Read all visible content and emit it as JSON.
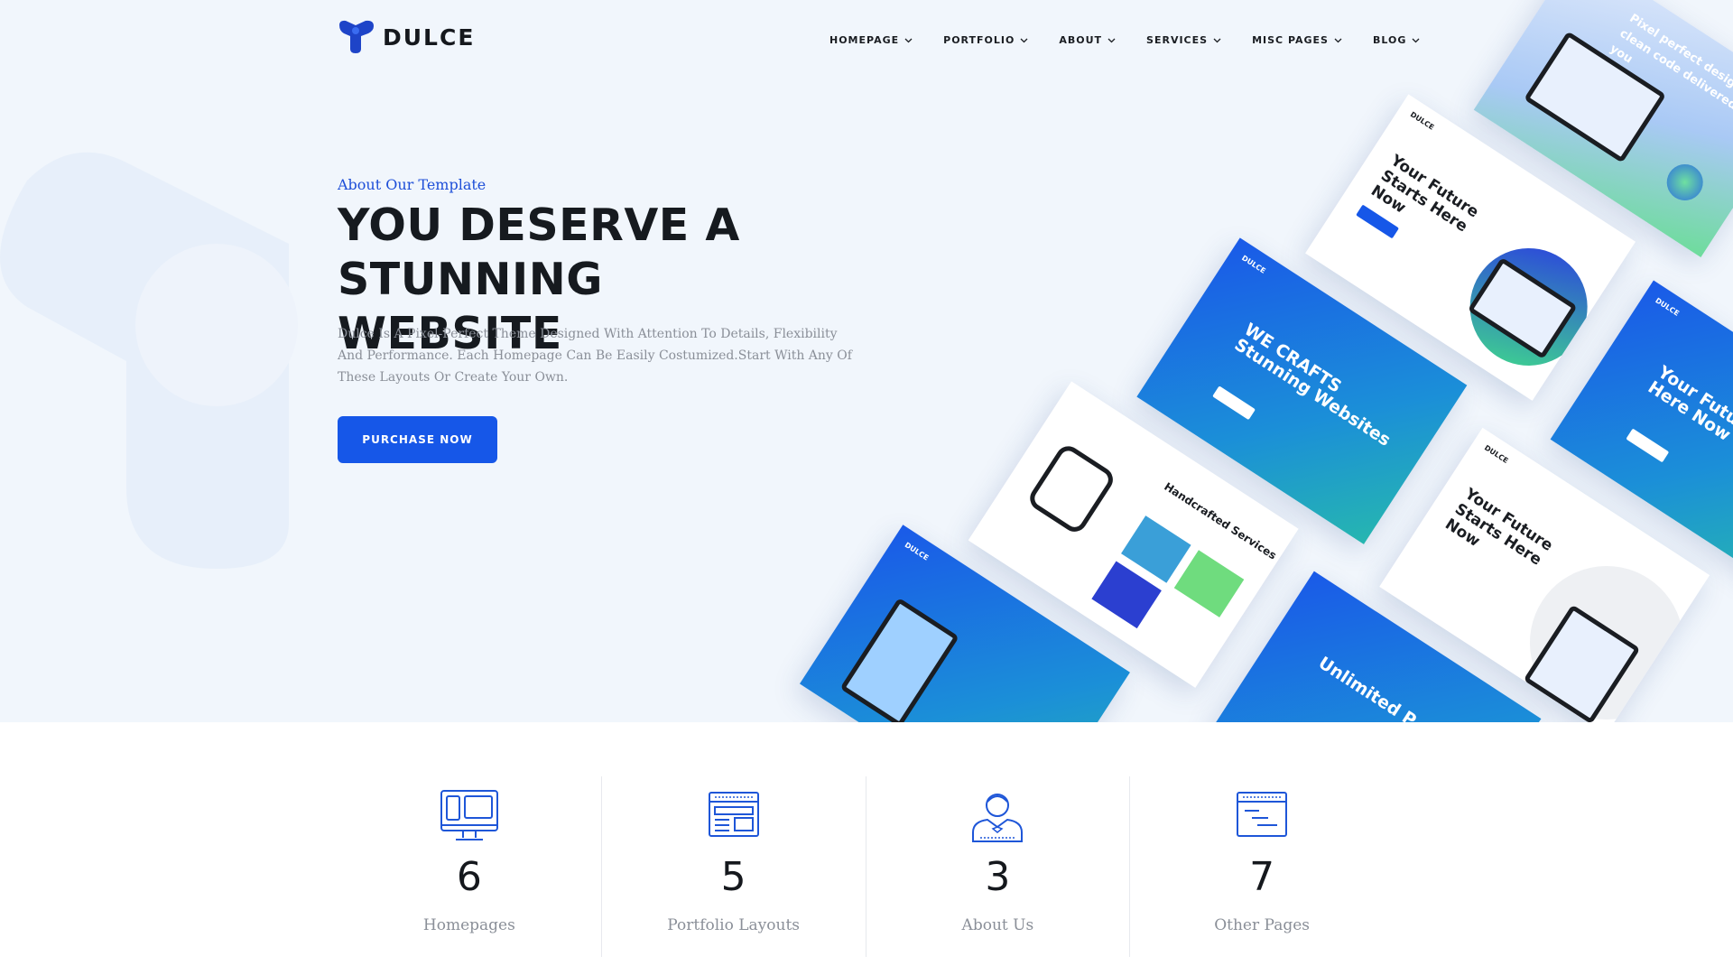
{
  "brand": {
    "name": "DULCE",
    "accent": "#1657e8"
  },
  "nav": {
    "items": [
      {
        "label": "HOMEPAGE"
      },
      {
        "label": "PORTFOLIO"
      },
      {
        "label": "ABOUT"
      },
      {
        "label": "SERVICES"
      },
      {
        "label": "MISC PAGES"
      },
      {
        "label": "BLOG"
      }
    ],
    "chevron_icon": "chevron-down-icon"
  },
  "hero": {
    "eyebrow": "About Our Template",
    "headline_line1": "YOU DESERVE A",
    "headline_line2": "STUNNING WEBSITE",
    "description": "Dulce Is A Pixel-Perfect Theme Designed With Attention To Details, Flexibility And Performance. Each Homepage Can Be Easily Costumized.Start With Any Of These Layouts Or Create Your Own.",
    "cta_label": "PURCHASE NOW"
  },
  "mockups": {
    "tile_1": "Pixel perfect design and clean code delivered to you",
    "tile_2": "Your Future Starts Here Now",
    "tile_3": "WE CRAFTS Stunning Websites",
    "tile_4": "Handcrafted Services",
    "tile_5": "Your Future Starts Here Now",
    "tile_6": "Unlimited P",
    "mini_logo": "DULCE"
  },
  "stats": [
    {
      "value": "6",
      "label": "Homepages",
      "icon": "desktop-devices-icon"
    },
    {
      "value": "5",
      "label": "Portfolio Layouts",
      "icon": "browser-layout-icon"
    },
    {
      "value": "3",
      "label": "About Us",
      "icon": "person-icon"
    },
    {
      "value": "7",
      "label": "Other Pages",
      "icon": "document-window-icon"
    }
  ]
}
